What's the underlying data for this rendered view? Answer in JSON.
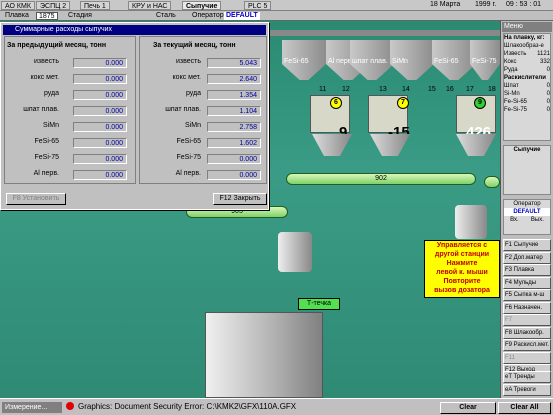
{
  "top": {
    "btn1": "АО КМК",
    "btn2": "ЭСПЦ 2",
    "btn3": "Печь 1",
    "btn4": "КРУ и НАС",
    "btn5": "Сыпучие",
    "btn6": "PLC 5",
    "date": "18  Марта",
    "year": "1999  г.",
    "time": "09 : 53 : 01"
  },
  "bar2": {
    "plavka_label": "Плавка",
    "plavka": "1875",
    "stadia_label": "Стадия",
    "stal_label": "Сталь",
    "operator_label": "Оператор",
    "operator": "DEFAULT"
  },
  "dialog": {
    "title": "Суммарные расходы сыпучих",
    "prev_header": "За предыдущий месяц, тонн",
    "cur_header": "За текущий месяц, тонн",
    "rows": [
      {
        "label": "известь",
        "prev": "0.000",
        "cur": "5.043"
      },
      {
        "label": "кокс мет.",
        "prev": "0.000",
        "cur": "2.640"
      },
      {
        "label": "руда",
        "prev": "0.000",
        "cur": "1.354"
      },
      {
        "label": "шпат плав.",
        "prev": "0.000",
        "cur": "1.104"
      },
      {
        "label": "SiMn",
        "prev": "0.000",
        "cur": "2.758"
      },
      {
        "label": "FeSi-65",
        "prev": "0.000",
        "cur": "1.602"
      },
      {
        "label": "FeSi-75",
        "prev": "0.000",
        "cur": "0.000"
      },
      {
        "label": "Al перв.",
        "prev": "0.000",
        "cur": "0.000"
      }
    ],
    "btn_set": "F8 Установить",
    "btn_close": "F12 Закрыть"
  },
  "scene": {
    "h1": "FeSi-65",
    "h2": "Al перв",
    "h3": "шпат плав.",
    "h4": "SiMn",
    "h5": "FeSi-65",
    "h6": "FeSi-75",
    "n11": "11",
    "n12": "12",
    "n13": "13",
    "n14": "14",
    "n15": "15",
    "n16": "16",
    "n17": "17",
    "n18": "18",
    "c6": "6",
    "c7": "7",
    "c9": "9",
    "v1": "9",
    "v2": "-15",
    "v3": "426",
    "conv1": "902",
    "conv2": "905",
    "tecka": "Т-течка"
  },
  "right": {
    "title": "Меню",
    "head": "На плавку, кг:",
    "head2": "Шлакообраз-е",
    "izv_l": "Известь",
    "izv_v": "1121",
    "koks_l": "Кокс",
    "koks_v": "332",
    "ruda_l": "Руда",
    "ruda_v": "0",
    "rasks": "Раскислители",
    "shpat_l": "Шпат",
    "shpat_v": "0",
    "simn_l": "Si-Mn",
    "simn_v": "0",
    "fe65_l": "Fe-Si-65",
    "fe65_v": "0",
    "fe75_l": "Fe-Si-75",
    "fe75_v": "0",
    "syp": "Сыпучие",
    "oper": "Оператор",
    "oper_v": "DEFAULT",
    "vk": "Вх.",
    "vy": "Вых.",
    "keys": [
      "F1 Сыпучие",
      "F2 Доп.матер",
      "F3 Плавка",
      "F4 Мульды",
      "F5 Сыпка м-ш",
      "F6 Назначен.",
      "F7",
      "F8 Шлакообр.",
      "F9 Раскисл.мет.",
      "F11",
      "F12 Выход",
      "eT Тренды",
      "eA Тревоги"
    ]
  },
  "msg": {
    "l1": "Управляется с",
    "l2": "другой станции",
    "l3": "Нажмите",
    "l4": "левой к. мыши",
    "l5": "Повторите",
    "l6": "вызов дозатора"
  },
  "status": {
    "task": "Измерение...",
    "text": "Graphics: Document Security Error: C:\\KMK2\\GFX\\110A.GFX",
    "clear": "Clear",
    "clear_all": "Clear All"
  }
}
